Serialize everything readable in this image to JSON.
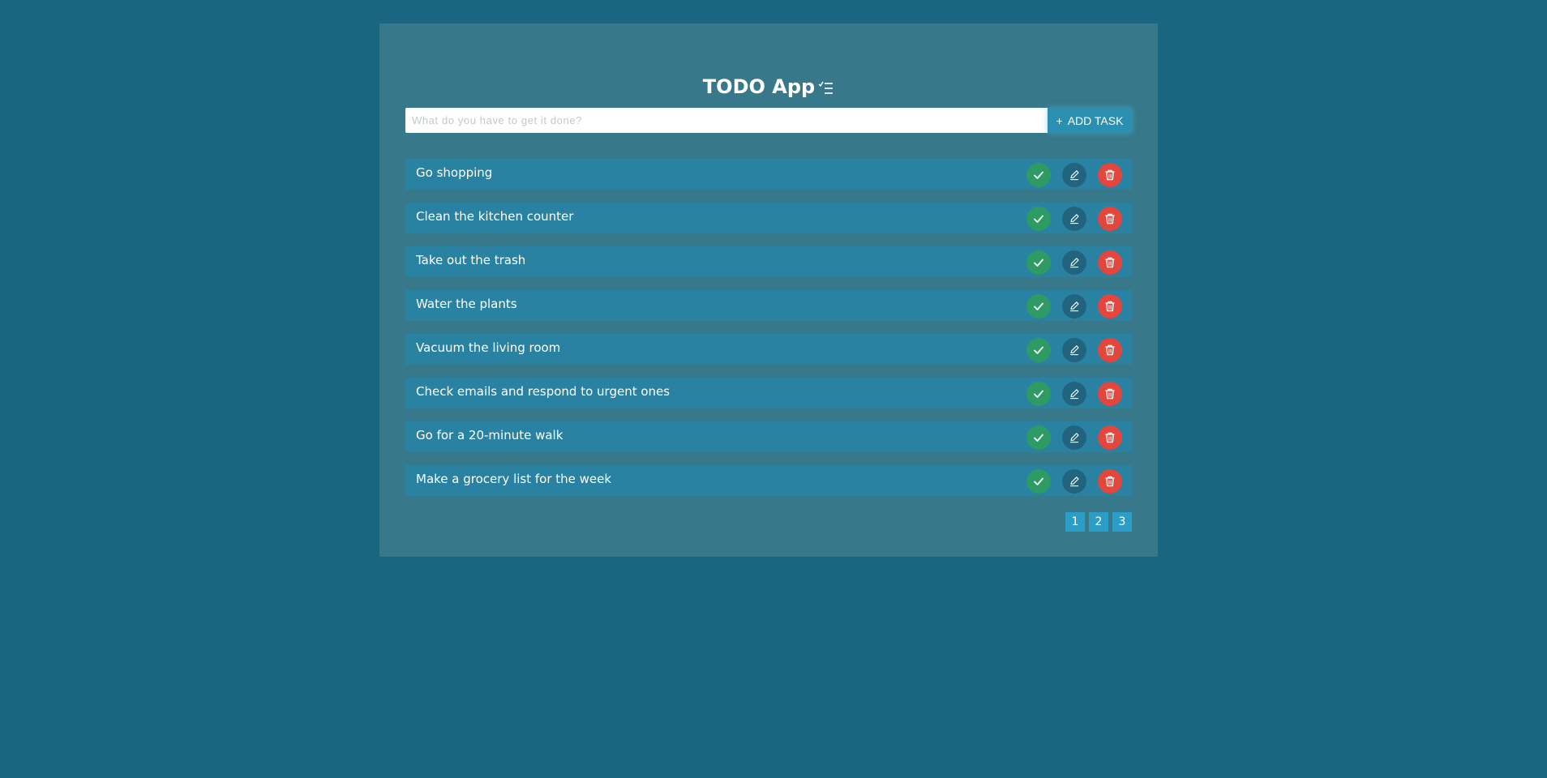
{
  "app": {
    "title": "TODO App",
    "title_icon": "checklist-icon"
  },
  "new_task": {
    "placeholder": "What do you have to get it done?",
    "value": "",
    "add_button_icon": "+",
    "add_button_label": "ADD TASK"
  },
  "tasks": [
    {
      "label": "Go shopping"
    },
    {
      "label": "Clean the kitchen counter"
    },
    {
      "label": "Take out the trash"
    },
    {
      "label": "Water the plants"
    },
    {
      "label": "Vacuum the living room"
    },
    {
      "label": "Check emails and respond to urgent ones"
    },
    {
      "label": "Go for a 20-minute walk"
    },
    {
      "label": "Make a grocery list for the week"
    }
  ],
  "task_actions": [
    {
      "name": "complete",
      "icon": "check-icon",
      "color": "#2e9b64"
    },
    {
      "name": "edit",
      "icon": "pencil-icon",
      "color": "#22647e"
    },
    {
      "name": "delete",
      "icon": "trash-icon",
      "color": "#e2463d"
    }
  ],
  "pagination": {
    "pages": [
      "1",
      "2",
      "3"
    ]
  },
  "colors": {
    "background": "#1a6680",
    "card": "#37788a",
    "task_row": "#2a82a2",
    "accent": "#2b9dc6"
  }
}
